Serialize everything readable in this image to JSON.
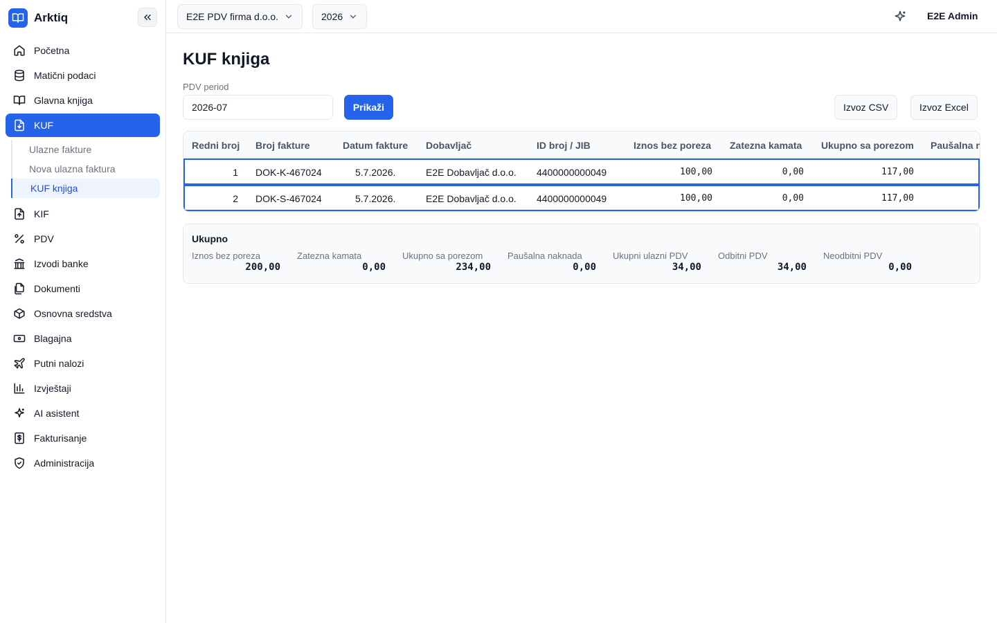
{
  "app": {
    "name": "Arktiq"
  },
  "sidebar": {
    "items": [
      {
        "label": "Početna",
        "icon": "home-icon"
      },
      {
        "label": "Matični podaci",
        "icon": "database-icon"
      },
      {
        "label": "Glavna knjiga",
        "icon": "book-open-icon"
      },
      {
        "label": "KUF",
        "icon": "file-download-icon",
        "active": true
      },
      {
        "label": "KIF",
        "icon": "file-upload-icon"
      },
      {
        "label": "PDV",
        "icon": "percent-icon"
      },
      {
        "label": "Izvodi banke",
        "icon": "bank-icon"
      },
      {
        "label": "Dokumenti",
        "icon": "documents-icon"
      },
      {
        "label": "Osnovna sredstva",
        "icon": "box-icon"
      },
      {
        "label": "Blagajna",
        "icon": "cash-icon"
      },
      {
        "label": "Putni nalozi",
        "icon": "plane-icon"
      },
      {
        "label": "Izvještaji",
        "icon": "bar-chart-icon"
      },
      {
        "label": "AI asistent",
        "icon": "sparkle-icon"
      },
      {
        "label": "Fakturisanje",
        "icon": "invoice-dollar-icon"
      },
      {
        "label": "Administracija",
        "icon": "shield-check-icon"
      }
    ],
    "kuf_sub": [
      {
        "label": "Ulazne fakture"
      },
      {
        "label": "Nova ulazna faktura"
      },
      {
        "label": "KUF knjiga",
        "active": true
      }
    ]
  },
  "topbar": {
    "company": "E2E PDV firma d.o.o.",
    "year": "2026",
    "user": "E2E Admin"
  },
  "page": {
    "title": "KUF knjiga",
    "period_label": "PDV period",
    "period_value": "2026-07",
    "show_button": "Prikaži",
    "export_csv": "Izvoz CSV",
    "export_excel": "Izvoz Excel"
  },
  "table": {
    "headers": [
      "Redni broj",
      "Broj fakture",
      "Datum fakture",
      "Dobavljač",
      "ID broj / JIB",
      "Iznos bez poreza",
      "Zatezna kamata",
      "Ukupno sa porezom",
      "Paušalna n"
    ],
    "rows": [
      {
        "rb": "1",
        "broj": "DOK-K-467024",
        "datum": "5.7.2026.",
        "dobavljac": "E2E Dobavljač d.o.o.",
        "jib": "4400000000049",
        "iznos": "100,00",
        "kamata": "0,00",
        "ukupno": "117,00"
      },
      {
        "rb": "2",
        "broj": "DOK-S-467024",
        "datum": "5.7.2026.",
        "dobavljac": "E2E Dobavljač d.o.o.",
        "jib": "4400000000049",
        "iznos": "100,00",
        "kamata": "0,00",
        "ukupno": "117,00"
      }
    ]
  },
  "summary": {
    "title": "Ukupno",
    "items": [
      {
        "label": "Iznos bez poreza",
        "value": "200,00"
      },
      {
        "label": "Zatezna kamata",
        "value": "0,00"
      },
      {
        "label": "Ukupno sa porezom",
        "value": "234,00"
      },
      {
        "label": "Paušalna naknada",
        "value": "0,00"
      },
      {
        "label": "Ukupni ulazni PDV",
        "value": "34,00"
      },
      {
        "label": "Odbitni PDV",
        "value": "34,00"
      },
      {
        "label": "Neodbitni PDV",
        "value": "0,00"
      }
    ]
  },
  "colors": {
    "accent": "#2563eb",
    "active_sub_bg": "#eef4ff",
    "border": "#e5e7eb"
  }
}
